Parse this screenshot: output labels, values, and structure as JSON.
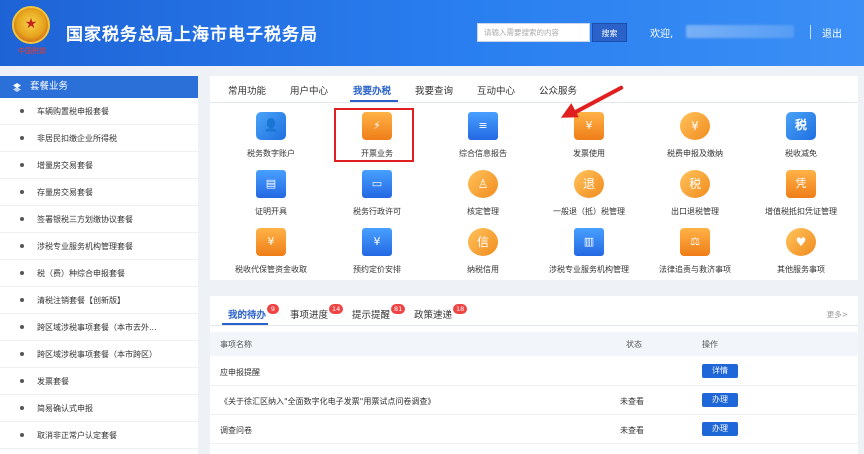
{
  "header": {
    "emblem_text": "中国税徽",
    "title": "国家税务总局上海市电子税务局",
    "search_placeholder": "请输入需要搜索的内容",
    "search_button": "搜索",
    "welcome": "欢迎,",
    "logout": "退出"
  },
  "sidebar": {
    "title": "套餐业务",
    "items": [
      "车辆购置税申报套餐",
      "非居民扣缴企业所得税",
      "增量房交易套餐",
      "存量房交易套餐",
      "签署银税三方划缴协议套餐",
      "涉税专业服务机构管理套餐",
      "税（费）种综合申报套餐",
      "清税注销套餐【创新版】",
      "跨区域涉税事项套餐（本市去外...",
      "跨区域涉税事项套餐（本市跨区）",
      "发票套餐",
      "简易确认式申报",
      "取消非正常户认定套餐"
    ]
  },
  "main": {
    "tabs": [
      "常用功能",
      "用户中心",
      "我要办税",
      "我要查询",
      "互动中心",
      "公众服务"
    ],
    "active_tab": "我要办税",
    "services": [
      {
        "label": "税务数字账户",
        "icon": "account-icon",
        "glyph": "👤"
      },
      {
        "label": "开票业务",
        "icon": "invoice-issue-icon",
        "glyph": "⚡"
      },
      {
        "label": "综合信息报告",
        "icon": "report-icon",
        "glyph": "≡"
      },
      {
        "label": "发票使用",
        "icon": "invoice-use-icon",
        "glyph": "¥"
      },
      {
        "label": "税费申报及缴纳",
        "icon": "declare-pay-icon",
        "glyph": "¥"
      },
      {
        "label": "税收减免",
        "icon": "tax-relief-icon",
        "glyph": "税"
      },
      {
        "label": "证明开具",
        "icon": "certificate-icon",
        "glyph": "▤"
      },
      {
        "label": "税务行政许可",
        "icon": "permit-icon",
        "glyph": "▭"
      },
      {
        "label": "核定管理",
        "icon": "assessment-icon",
        "glyph": "♙"
      },
      {
        "label": "一般退（抵）税管理",
        "icon": "refund-icon",
        "glyph": "退"
      },
      {
        "label": "出口退税管理",
        "icon": "export-refund-icon",
        "glyph": "税"
      },
      {
        "label": "增值税抵扣凭证管理",
        "icon": "vat-voucher-icon",
        "glyph": "凭"
      },
      {
        "label": "税收代保管资金收取",
        "icon": "custody-fund-icon",
        "glyph": "¥"
      },
      {
        "label": "预约定价安排",
        "icon": "pricing-icon",
        "glyph": "¥"
      },
      {
        "label": "纳税信用",
        "icon": "credit-icon",
        "glyph": "信"
      },
      {
        "label": "涉税专业服务机构管理",
        "icon": "agency-icon",
        "glyph": "▥"
      },
      {
        "label": "法律追责与救济事项",
        "icon": "legal-icon",
        "glyph": "⚖"
      },
      {
        "label": "其他服务事项",
        "icon": "other-service-icon",
        "glyph": "♥"
      }
    ]
  },
  "todo": {
    "tabs": [
      {
        "label": "我的待办",
        "count": "9"
      },
      {
        "label": "事项进度",
        "count": "14"
      },
      {
        "label": "提示提醒",
        "count": "81"
      },
      {
        "label": "政策速递",
        "count": "18"
      }
    ],
    "more": "更多>",
    "columns": [
      "事项名称",
      "状态",
      "操作"
    ],
    "rows": [
      {
        "name": "应申报提醒",
        "status": "",
        "action": "详情"
      },
      {
        "name": "《关于徐汇区纳入\"全面数字化电子发票\"用票试点问卷调查》",
        "status": "未查看",
        "action": "办理"
      },
      {
        "name": "调查问卷",
        "status": "未查看",
        "action": "办理"
      }
    ]
  }
}
